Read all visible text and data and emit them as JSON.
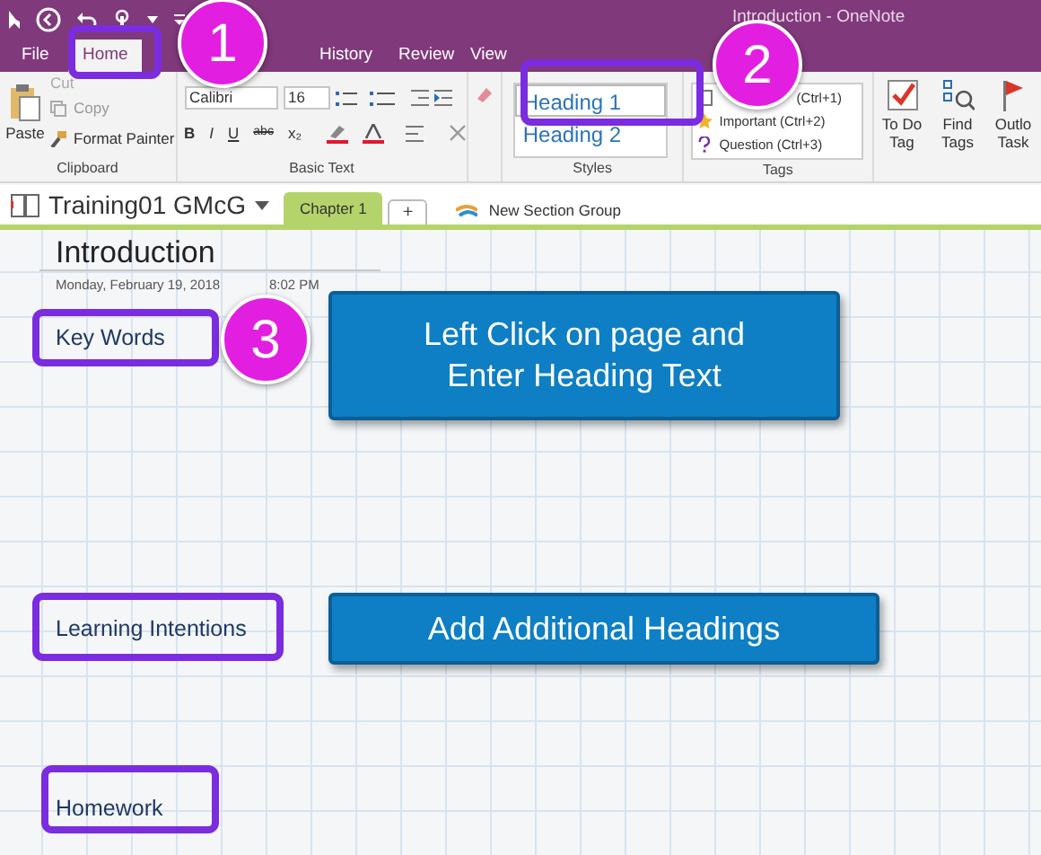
{
  "window": {
    "title": "Introduction - OneNote"
  },
  "tabs": [
    {
      "label": "File",
      "selected": false
    },
    {
      "label": "Home",
      "selected": true
    },
    {
      "label": "History",
      "selected": false
    },
    {
      "label": "Review",
      "selected": false
    },
    {
      "label": "View",
      "selected": false
    }
  ],
  "clipboard": {
    "label": "Clipboard",
    "paste": "Paste",
    "cut": "Cut",
    "copy": "Copy",
    "format_painter": "Format Painter"
  },
  "basic_text": {
    "label": "Basic Text",
    "font": "Calibri",
    "size": "16",
    "format_buttons": [
      "B",
      "I",
      "U",
      "abc",
      "x₂"
    ]
  },
  "styles": {
    "label": "Styles",
    "items": [
      {
        "label": "Heading 1",
        "selected": true
      },
      {
        "label": "Heading 2",
        "selected": false
      }
    ]
  },
  "tags": {
    "label": "Tags",
    "items": [
      {
        "label": "(Ctrl+1)",
        "kind": "todo"
      },
      {
        "label": "Important (Ctrl+2)",
        "kind": "star"
      },
      {
        "label": "Question (Ctrl+3)",
        "kind": "question"
      }
    ],
    "buttons": [
      {
        "label": "To Do Tag",
        "kind": "todo"
      },
      {
        "label": "Find Tags",
        "kind": "find"
      },
      {
        "label": "Outlo Task",
        "kind": "flag"
      }
    ]
  },
  "notebook": {
    "name": "Training01 GMcG",
    "sections": [
      {
        "label": "Chapter 1",
        "selected": true
      }
    ],
    "add": "+",
    "new_section_group": "New Section Group"
  },
  "page": {
    "title": "Introduction",
    "date": "Monday, February 19, 2018",
    "time": "8:02 PM",
    "headings": [
      "Key Words",
      "Learning Intentions",
      "Homework"
    ]
  },
  "annotations": {
    "steps": [
      "1",
      "2",
      "3"
    ],
    "callouts": [
      "Left Click on page and Enter Heading Text",
      "Add Additional Headings"
    ]
  }
}
